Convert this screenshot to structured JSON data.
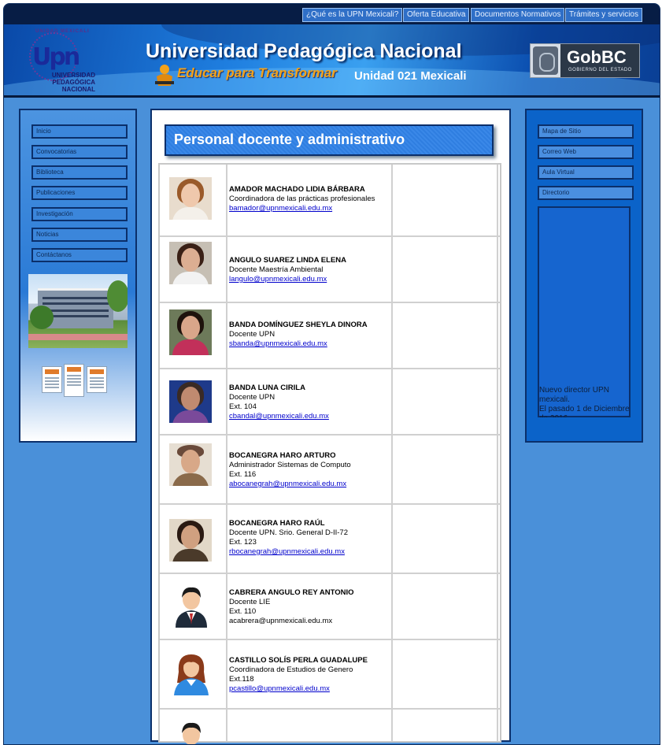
{
  "topnav": {
    "items": [
      "¿Qué es la UPN Mexicali?",
      "Oferta Educativa",
      "Documentos Normativos",
      "Trámites y servicios"
    ]
  },
  "header": {
    "logo_ring_text": "UNIDAD MEXICALI",
    "logo_letters": "Upn",
    "logo_text": [
      "UNIVERSIDAD",
      "PEDAGÓGICA",
      "NACIONAL"
    ],
    "title": "Universidad Pedagógica Nacional",
    "slogan": "Educar para Transformar",
    "unit": "Unidad 021 Mexicali",
    "gob_name": "GobBC",
    "gob_sub": "GOBIERNO DEL ESTADO"
  },
  "left_nav": {
    "items": [
      "Inicio",
      "Convocatorias",
      "Biblioteca",
      "Publicaciones",
      "Investigación",
      "Noticias",
      "Contáctanos"
    ]
  },
  "right_nav": {
    "items": [
      "Mapa de Sitio",
      "Correo Web",
      "Aula Virtual",
      "Directorio"
    ],
    "news": "Nuevo director UPN mexicali.\nEl pasado 1 de Diciembre de 2016"
  },
  "main": {
    "heading": "Personal docente y administrativo",
    "staff": [
      {
        "name": "AMADOR MACHADO LIDIA BÁRBARA",
        "role": "Coordinadora de las prácticas profesionales",
        "ext": "",
        "email": "bamador@upnmexicali.edu.mx",
        "photo": "woman-light-hair"
      },
      {
        "name": "ANGULO SUAREZ LINDA ELENA",
        "role": "Docente Maestría Ambiental",
        "ext": "",
        "email": "langulo@upnmexicali.edu.mx",
        "photo": "woman-dark-hair"
      },
      {
        "name": "BANDA DOMÍNGUEZ SHEYLA DINORA",
        "role": "Docente UPN",
        "ext": "",
        "email": "sbanda@upnmexicali.edu.mx",
        "photo": "woman-dark-hair"
      },
      {
        "name": "BANDA LUNA CIRILA",
        "role": "Docente UPN",
        "ext": "Ext. 104",
        "email": "cbandal@upnmexicali.edu.mx",
        "photo": "woman-purple"
      },
      {
        "name": "BOCANEGRA HARO ARTURO",
        "role": "Administrador Sistemas de Computo",
        "ext": "Ext. 116",
        "email": "abocanegrah@upnmexicali.edu.mx",
        "photo": "man-bald"
      },
      {
        "name": "BOCANEGRA HARO RAÚL",
        "role": "Docente UPN. Srio. General D-II-72",
        "ext": "Ext. 123",
        "email": "rbocanegrah@upnmexicali.edu.mx",
        "photo": "man-suit"
      },
      {
        "name": "CABRERA ANGULO REY ANTONIO",
        "role": "Docente LIE",
        "ext": "Ext. 110",
        "email": "acabrera@upnmexicali.edu.mx",
        "photo": "avatar-man"
      },
      {
        "name": "CASTILLO SOLÍS PERLA GUADALUPE",
        "role": "Coordinadora de Estudios de Genero",
        "ext": "Ext.118",
        "email": "pcastillo@upnmexicali.edu.mx",
        "photo": "avatar-woman"
      }
    ]
  },
  "colors": {
    "page_blue": "#4a90d9",
    "nav_dark": "#071d45",
    "link": "#0000cc",
    "slogan": "#f3a21a"
  }
}
